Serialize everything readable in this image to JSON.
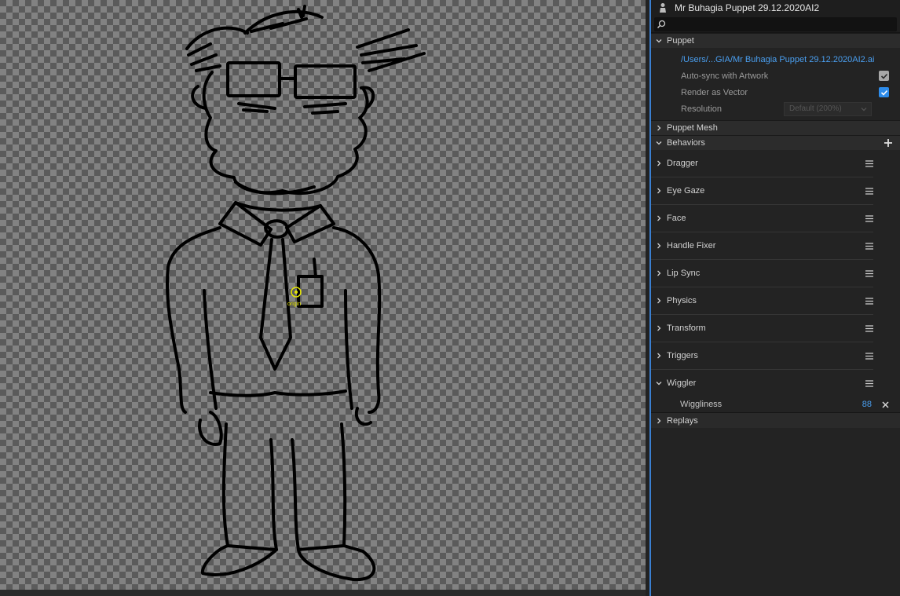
{
  "puppet_name": "Mr Buhagia Puppet 29.12.2020AI2",
  "search": {
    "placeholder": ""
  },
  "stage": {
    "origin_label": "origin"
  },
  "sections": {
    "puppet": {
      "title": "Puppet",
      "file_path": "/Users/...GIA/Mr Buhagia Puppet 29.12.2020AI2.ai",
      "auto_sync_label": "Auto-sync with Artwork",
      "auto_sync_checked": true,
      "render_vector_label": "Render as Vector",
      "render_vector_checked": true,
      "resolution_label": "Resolution",
      "resolution_value": "Default (200%)"
    },
    "puppet_mesh": {
      "title": "Puppet Mesh"
    },
    "behaviors": {
      "title": "Behaviors",
      "items": [
        {
          "label": "Dragger"
        },
        {
          "label": "Eye Gaze"
        },
        {
          "label": "Face"
        },
        {
          "label": "Handle Fixer"
        },
        {
          "label": "Lip Sync"
        },
        {
          "label": "Physics"
        },
        {
          "label": "Transform"
        },
        {
          "label": "Triggers"
        },
        {
          "label": "Wiggler"
        }
      ],
      "wiggler_param": {
        "label": "Wiggliness",
        "value": "88"
      }
    },
    "replays": {
      "title": "Replays"
    }
  },
  "colors": {
    "accent": "#2d8ceb",
    "link": "#4a9ff0",
    "origin": "#e6e600"
  }
}
